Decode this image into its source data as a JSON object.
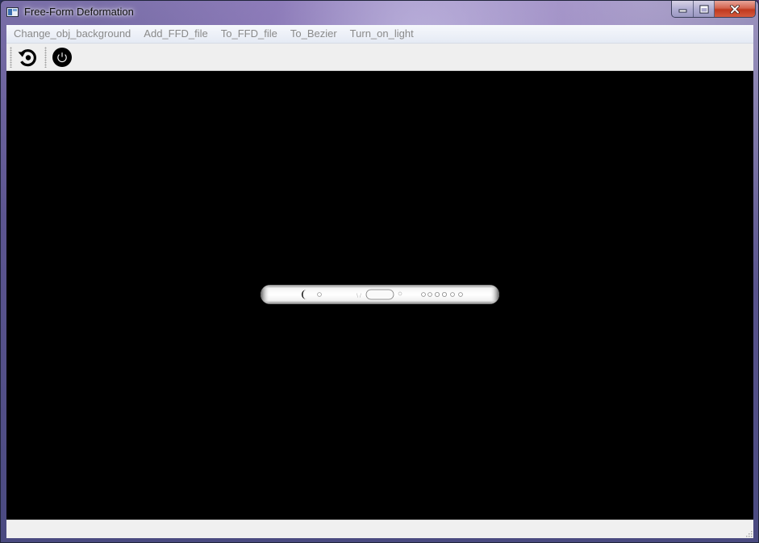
{
  "window": {
    "title": "Free-Form Deformation",
    "icon": "app-window-icon"
  },
  "caption_buttons": {
    "minimize_icon": "minimize-icon",
    "maximize_icon": "maximize-icon",
    "close_icon": "close-icon"
  },
  "menubar": {
    "items": [
      {
        "label": "Change_obj_background"
      },
      {
        "label": "Add_FFD_file"
      },
      {
        "label": "To_FFD_file"
      },
      {
        "label": "To_Bezier"
      },
      {
        "label": "Turn_on_light"
      }
    ],
    "text_color": "#8a8a8a"
  },
  "toolbar": {
    "buttons": [
      {
        "icon": "reset-rotate-icon"
      },
      {
        "icon": "power-icon"
      }
    ]
  },
  "viewport": {
    "background": "#000000",
    "object": "deformed-phone-model"
  },
  "colors": {
    "viewport_bg": "#000000",
    "toolbar_bg": "#efefef",
    "statusbar_bg": "#f0f0f0",
    "close_button": "#c0391f"
  }
}
